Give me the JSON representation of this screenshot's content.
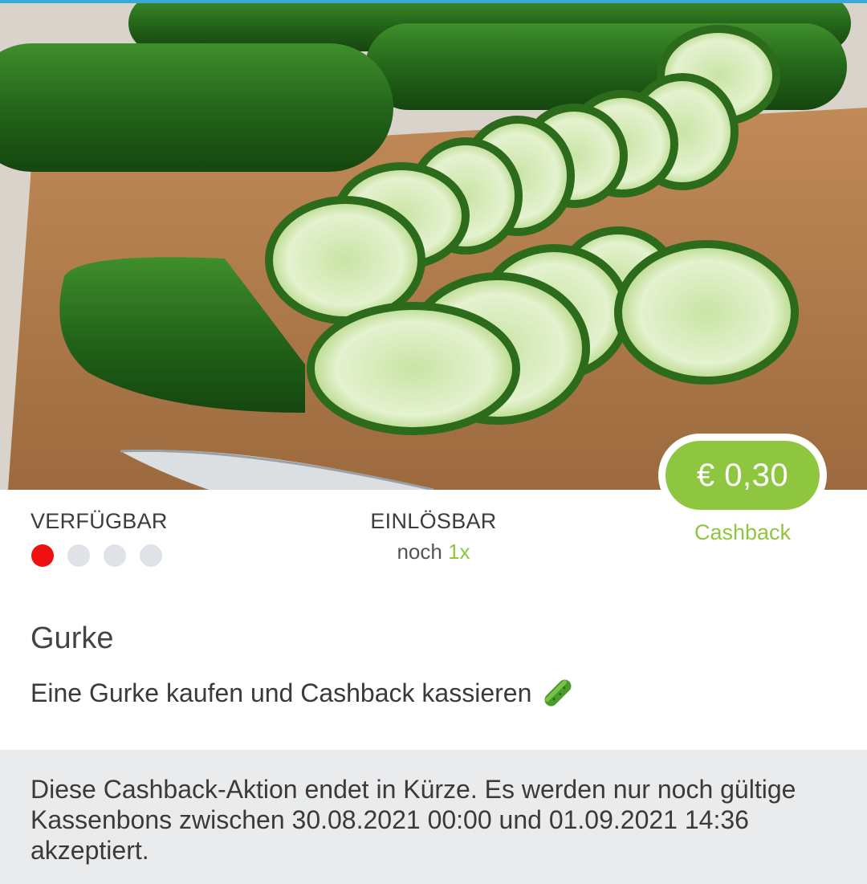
{
  "offer": {
    "price": "€ 0,30",
    "cashback_label": "Cashback"
  },
  "availability": {
    "label": "VERFÜGBAR",
    "level_filled": 1,
    "level_total": 4
  },
  "redeem": {
    "label": "EINLÖSBAR",
    "prefix": "noch",
    "count": "1x"
  },
  "product": {
    "title": "Gurke",
    "description": "Eine Gurke kaufen und Cashback kassieren",
    "emoji_icon": "cucumber-icon"
  },
  "notice": {
    "text": "Diese Cashback-Aktion endet in Kürze. Es werden nur noch gültige Kassenbons zwischen 30.08.2021 00:00 und 01.09.2021 14:36 akzeptiert."
  },
  "colors": {
    "accent_green": "#8ec63f",
    "active_dot": "#ee1111",
    "inactive_dot": "#dfe3e7",
    "notice_bg": "#e9ebed"
  }
}
